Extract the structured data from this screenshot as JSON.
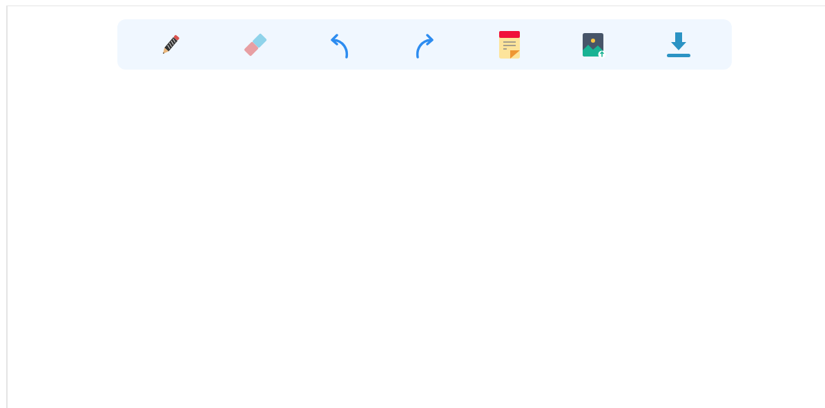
{
  "toolbar": {
    "tools": [
      {
        "kind": "pencil"
      },
      {
        "kind": "eraser"
      },
      {
        "kind": "undo"
      },
      {
        "kind": "redo"
      },
      {
        "kind": "note"
      },
      {
        "kind": "image-upload"
      },
      {
        "kind": "download"
      }
    ]
  }
}
